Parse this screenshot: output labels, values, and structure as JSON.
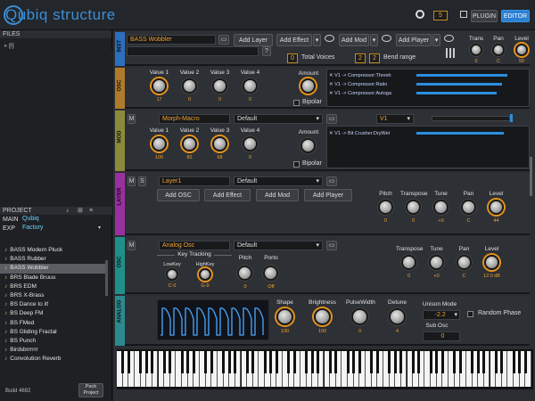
{
  "app": {
    "title": "Qubiq structure"
  },
  "topbar": {
    "counter": "5",
    "plugin_label": "PLUGIN",
    "editor_label": "EDITOR"
  },
  "sidebar": {
    "files_header": "FILES",
    "file_item": "[!]",
    "project_header": "PROJECT",
    "main_label": "MAIN",
    "main_value": "Qubiq",
    "exp_label": "EXP",
    "exp_value": "Factory",
    "files": [
      {
        "name": "BASS Modern Pluck",
        "selected": false
      },
      {
        "name": "BASS Rubber",
        "selected": false
      },
      {
        "name": "BASS Wobbler",
        "selected": true
      },
      {
        "name": "BRS Blade Bruuu",
        "selected": false
      },
      {
        "name": "BRS EDM",
        "selected": false
      },
      {
        "name": "BRS X-Brass",
        "selected": false
      },
      {
        "name": "BS Dance to it!",
        "selected": false
      },
      {
        "name": "BS Deep FM",
        "selected": false
      },
      {
        "name": "BS FMed",
        "selected": false
      },
      {
        "name": "BS Gliding Fractal",
        "selected": false
      },
      {
        "name": "BS Punch",
        "selected": false
      },
      {
        "name": "Birdsbrrrrrr",
        "selected": false
      },
      {
        "name": "Convolution Reverb",
        "selected": false
      }
    ],
    "build": "Build 4692",
    "pack_label": "Pack\nProject"
  },
  "inst": {
    "strip_label": "INST",
    "name": "BASS Wobbler",
    "add_layer": "Add Layer",
    "add_effect": "Add Effect",
    "add_mod": "Add Mod",
    "add_player": "Add Player",
    "help": "?",
    "voices_value": "0",
    "voices_label": "Total Voices",
    "bend_a": "2",
    "bend_b": "2",
    "bend_label": "Bend range",
    "trans_label": "Trans",
    "trans_value": "0",
    "pan_label": "Pan",
    "pan_value": "C",
    "level_label": "Level",
    "level_value": "50"
  },
  "osc_mod": {
    "strip_label": "OSC",
    "knobs": [
      {
        "label": "Value 1",
        "value": "17"
      },
      {
        "label": "Value 2",
        "value": "0"
      },
      {
        "label": "Value 3",
        "value": "0"
      },
      {
        "label": "Value 4",
        "value": "0"
      }
    ],
    "amount_label": "Amount",
    "bipolar_label": "Bipolar",
    "routes": [
      {
        "text": "V1 -> Compressor:Thresh",
        "level": 0.85
      },
      {
        "text": "V1 -> Compressor:Ratio",
        "level": 0.8
      },
      {
        "text": "V1 -> Compressor:Autoga",
        "level": 0.75
      }
    ]
  },
  "mod": {
    "strip_label": "MOD",
    "name": "Morph-Macro",
    "preset": "Default",
    "target": "V1",
    "knobs": [
      {
        "label": "Value 1",
        "value": "100"
      },
      {
        "label": "Value 2",
        "value": "82"
      },
      {
        "label": "Value 3",
        "value": "68"
      },
      {
        "label": "Value 4",
        "value": "0"
      }
    ],
    "amount_label": "Amount",
    "bipolar_label": "Bipolar",
    "route": "V1 -> Bit Crusher:DryWet",
    "route_level": 0.82
  },
  "layer": {
    "strip_label": "LAYER",
    "name": "Layer1",
    "preset": "Default",
    "add_osc": "Add OSC",
    "add_effect": "Add Effect",
    "add_mod": "Add Mod",
    "add_player": "Add Player",
    "knobs": [
      {
        "label": "Pitch",
        "value": "0"
      },
      {
        "label": "Transpose",
        "value": "0"
      },
      {
        "label": "Tune",
        "value": "+0"
      },
      {
        "label": "Pan",
        "value": "C"
      },
      {
        "label": "Level",
        "value": "44"
      }
    ]
  },
  "osc": {
    "strip_label": "OSC",
    "name": "Analog Osc",
    "preset": "Default",
    "key_tracking": "Key Tracking",
    "lowkey_label": "LowKey",
    "lowkey_value": "C-0",
    "highkey_label": "HighKey",
    "highkey_value": "G-9",
    "pitch_label": "Pitch",
    "pitch_value": "0",
    "porto_label": "Porto",
    "porto_value": "Off",
    "knobs": [
      {
        "label": "Transpose",
        "value": "0"
      },
      {
        "label": "Tune",
        "value": "+0"
      },
      {
        "label": "Pan",
        "value": "C"
      },
      {
        "label": "Level",
        "value": "12.0 dB"
      }
    ]
  },
  "analog": {
    "strip_label": "ANALOG",
    "knobs": [
      {
        "label": "Shape",
        "value": "100"
      },
      {
        "label": "Brightness",
        "value": "100"
      },
      {
        "label": "PulseWidth",
        "value": "0"
      },
      {
        "label": "Detune",
        "value": "4"
      }
    ],
    "unison_label": "Unison Mode",
    "unison_value": "-2.2",
    "random_phase": "Random Phase",
    "sub_osc_label": "Sub Osc",
    "sub_osc_value": "0"
  },
  "colors": {
    "accent": "#2c7fd1",
    "orange": "#f0a030",
    "inst": "#2d6fbf",
    "osc1": "#b07a2a",
    "mod": "#8a8a3a",
    "layer": "#9a2fa0",
    "osc2": "#1f8f8a",
    "analog": "#2a8a8e"
  }
}
